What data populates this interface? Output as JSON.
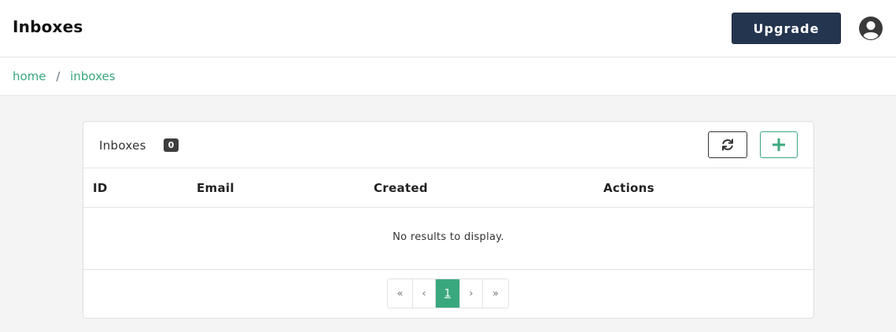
{
  "header": {
    "title": "Inboxes",
    "upgrade_label": "Upgrade",
    "accent_color": "#24354f"
  },
  "breadcrumb": {
    "items": [
      "home",
      "inboxes"
    ],
    "separator": "/"
  },
  "card": {
    "title": "Inboxes",
    "count": "0",
    "refresh_icon": "refresh-icon",
    "add_icon": "plus-icon",
    "accent_color": "#3aa87e"
  },
  "table": {
    "columns": [
      "ID",
      "Email",
      "Created",
      "Actions"
    ],
    "rows": [],
    "empty_message": "No results to display."
  },
  "pagination": {
    "first": "«",
    "prev": "‹",
    "current": "1",
    "next": "›",
    "last": "»"
  }
}
